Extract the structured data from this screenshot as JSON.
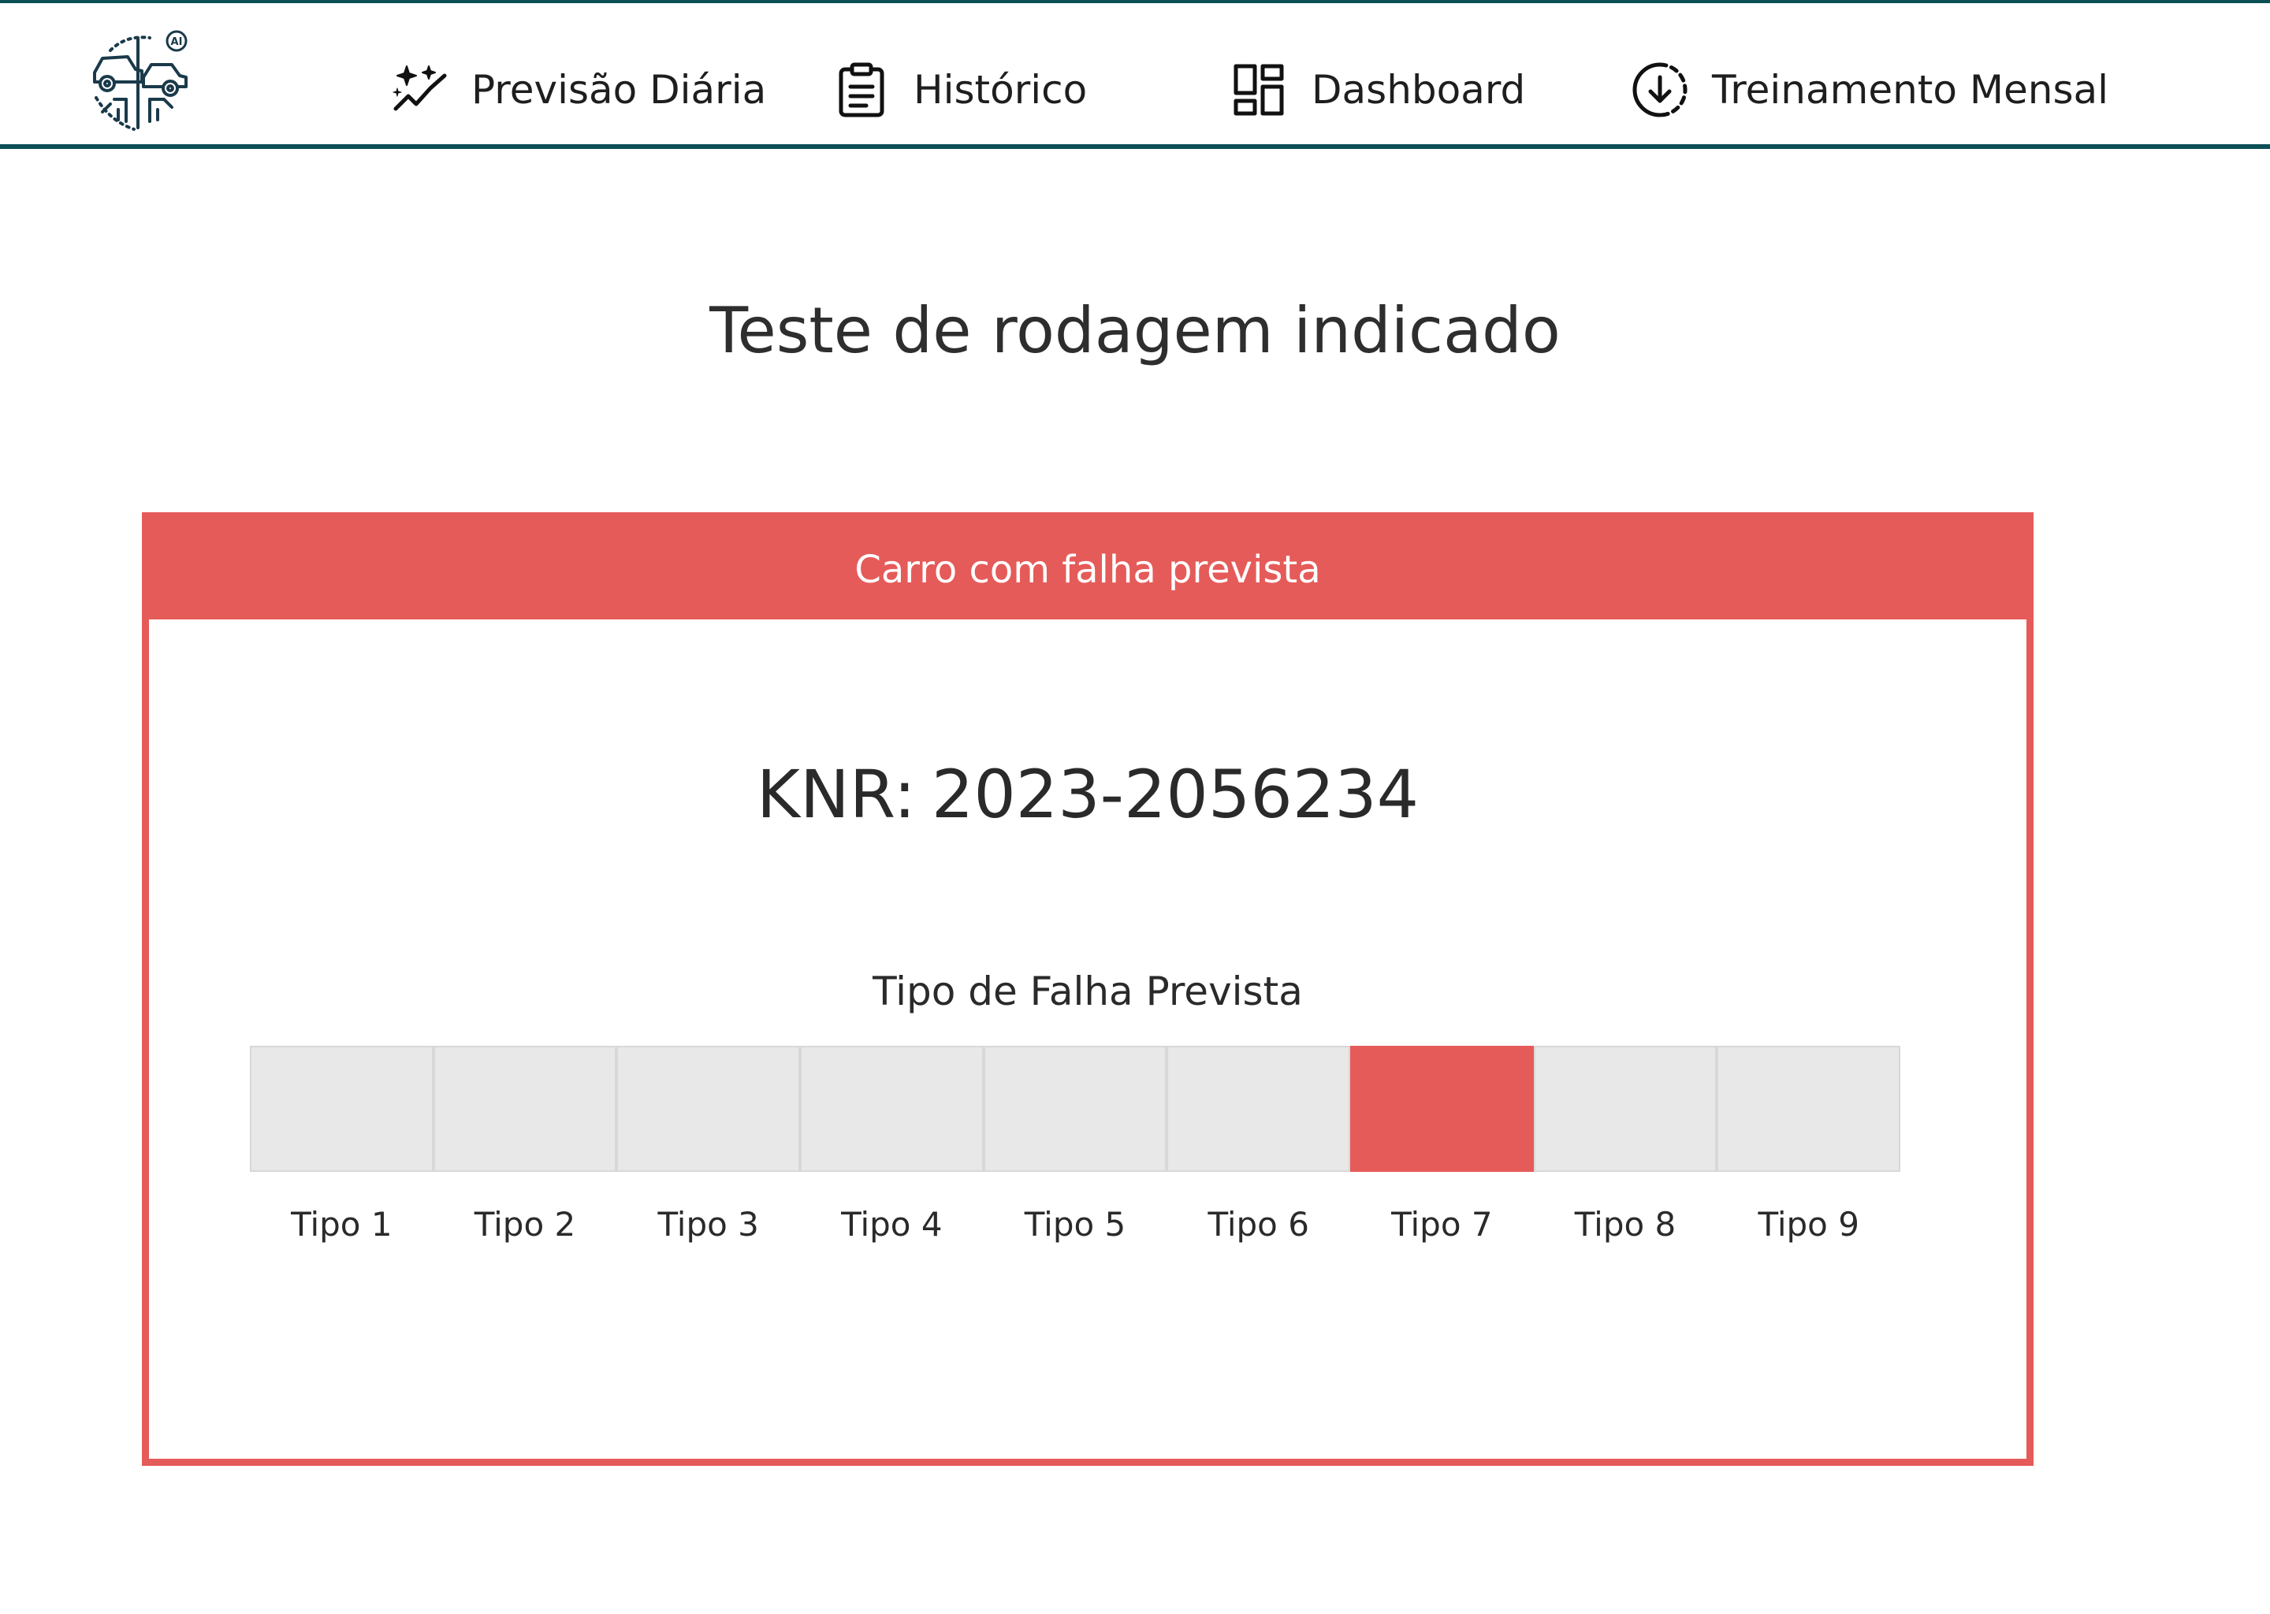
{
  "nav": {
    "items": [
      {
        "label": "Previsão Diária",
        "icon": "sparkle-trend-icon"
      },
      {
        "label": "Histórico",
        "icon": "clipboard-icon"
      },
      {
        "label": "Dashboard",
        "icon": "dashboard-icon"
      },
      {
        "label": "Treinamento Mensal",
        "icon": "download-circle-icon"
      }
    ],
    "border_color": "#0c4f55"
  },
  "logo": {
    "icon": "car-ai-logo",
    "badge_text": "AI"
  },
  "page": {
    "title": "Teste de rodagem indicado"
  },
  "card": {
    "header": "Carro com falha prevista",
    "knr_label": "KNR:",
    "knr_value": "2023-2056234",
    "accent_color": "#e55b59"
  },
  "fault": {
    "title": "Tipo de Falha Prevista",
    "types": [
      "Tipo 1",
      "Tipo 2",
      "Tipo 3",
      "Tipo 4",
      "Tipo 5",
      "Tipo 6",
      "Tipo 7",
      "Tipo 8",
      "Tipo 9"
    ],
    "selected": "Tipo 7"
  }
}
